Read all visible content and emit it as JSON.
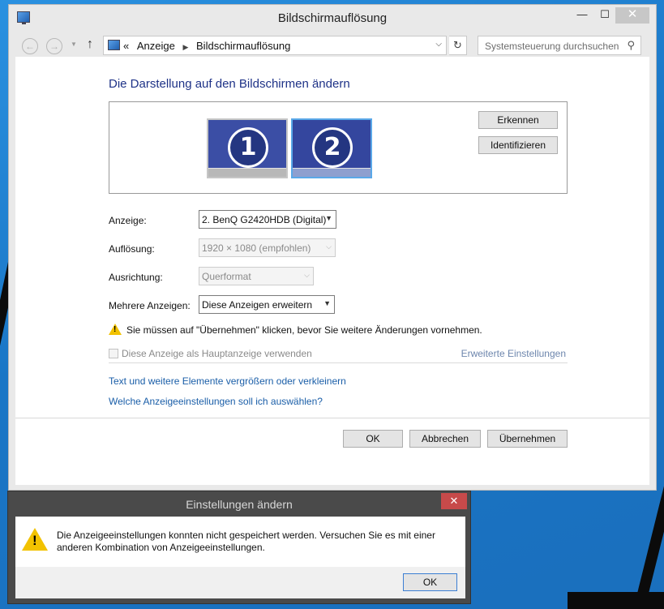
{
  "window": {
    "title": "Bildschirmauflösung",
    "minimize_glyph": "—",
    "maximize_glyph": "☐",
    "close_glyph": "✕"
  },
  "addressbar": {
    "breadcrumb_prefix": "«",
    "crumbs": [
      "Anzeige",
      "Bildschirmauflösung"
    ],
    "search_placeholder": "Systemsteuerung durchsuchen"
  },
  "main": {
    "heading": "Die Darstellung auf den Bildschirmen ändern",
    "monitors": [
      {
        "number": "1",
        "selected": false
      },
      {
        "number": "2",
        "selected": true
      }
    ],
    "detect_button": "Erkennen",
    "identify_button": "Identifizieren",
    "fields": {
      "display_label": "Anzeige:",
      "display_value": "2. BenQ G2420HDB (Digital)",
      "resolution_label": "Auflösung:",
      "resolution_value": "1920 × 1080 (empfohlen)",
      "orientation_label": "Ausrichtung:",
      "orientation_value": "Querformat",
      "multi_label": "Mehrere Anzeigen:",
      "multi_value": "Diese Anzeigen erweitern"
    },
    "warning_text": "Sie müssen auf \"Übernehmen\" klicken, bevor Sie weitere Änderungen vornehmen.",
    "main_display_checkbox": "Diese Anzeige als Hauptanzeige verwenden",
    "advanced_link": "Erweiterte Einstellungen",
    "links": [
      "Text und weitere Elemente vergrößern oder verkleinern",
      "Welche Anzeigeeinstellungen soll ich auswählen?"
    ],
    "buttons": {
      "ok": "OK",
      "cancel": "Abbrechen",
      "apply": "Übernehmen"
    }
  },
  "dialog": {
    "title": "Einstellungen ändern",
    "close_glyph": "✕",
    "message_line1": "Die Anzeigeeinstellungen konnten nicht gespeichert werden. Versuchen Sie es mit einer",
    "message_line2": "anderen Kombination von Anzeigeeinstellungen.",
    "ok": "OK"
  },
  "colors": {
    "heading": "#1e3287",
    "link": "#1a5ea8",
    "warning": "#f2c200",
    "dialog_close": "#c74a4a"
  }
}
